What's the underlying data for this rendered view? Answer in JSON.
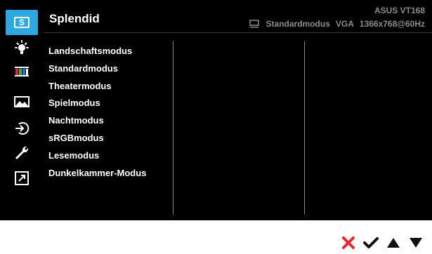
{
  "header": {
    "title": "Splendid",
    "model": "ASUS VT168",
    "status": {
      "mode": "Standardmodus",
      "input": "VGA",
      "resolution": "1366x768@60Hz"
    }
  },
  "sidebar": {
    "items": [
      {
        "icon": "splendid-s-icon",
        "badge": "S",
        "active": true
      },
      {
        "icon": "brightness-icon"
      },
      {
        "icon": "color-bars-icon"
      },
      {
        "icon": "image-icon"
      },
      {
        "icon": "input-select-icon"
      },
      {
        "icon": "wrench-icon"
      },
      {
        "icon": "shortcut-icon"
      }
    ]
  },
  "menu": {
    "items": [
      "Landschaftsmodus",
      "Standardmodus",
      "Theatermodus",
      "Spielmodus",
      "Nachtmodus",
      "sRGBmodus",
      "Lesemodus",
      "Dunkelkammer-Modus"
    ]
  },
  "controls": [
    {
      "icon": "close-icon",
      "color": "#e8262b"
    },
    {
      "icon": "checkmark-icon",
      "color": "#111111"
    },
    {
      "icon": "up-arrow-icon",
      "color": "#111111"
    },
    {
      "icon": "down-arrow-icon",
      "color": "#111111"
    }
  ],
  "colors": {
    "accent": "#2fa8e0",
    "background": "#000000",
    "text": "#ffffff",
    "muted": "#8c8c8c"
  }
}
